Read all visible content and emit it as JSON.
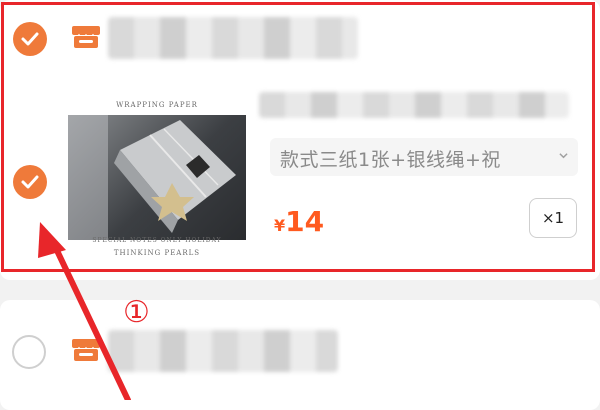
{
  "shop_top": {
    "name_masked": ""
  },
  "item": {
    "image_caption_top": "WRAPPING PAPER",
    "image_caption_bottom_1": "SPECIAL  NOTES  ONLY  HOLIDAY",
    "image_caption_bottom_2": "THINKING PEARLS",
    "variant": "款式三纸1张+银线绳+祝",
    "price_currency": "¥",
    "price_value": "14",
    "quantity": "×1"
  },
  "annotation": {
    "step_marker": "①",
    "color": "#e8262a"
  },
  "colors": {
    "accent": "#ef7a3a",
    "price": "#ff5a1f"
  },
  "icons": [
    "checkbox-checked-icon",
    "store-icon",
    "chevron-down-icon",
    "checkbox-empty-icon",
    "arrow-annotation"
  ]
}
